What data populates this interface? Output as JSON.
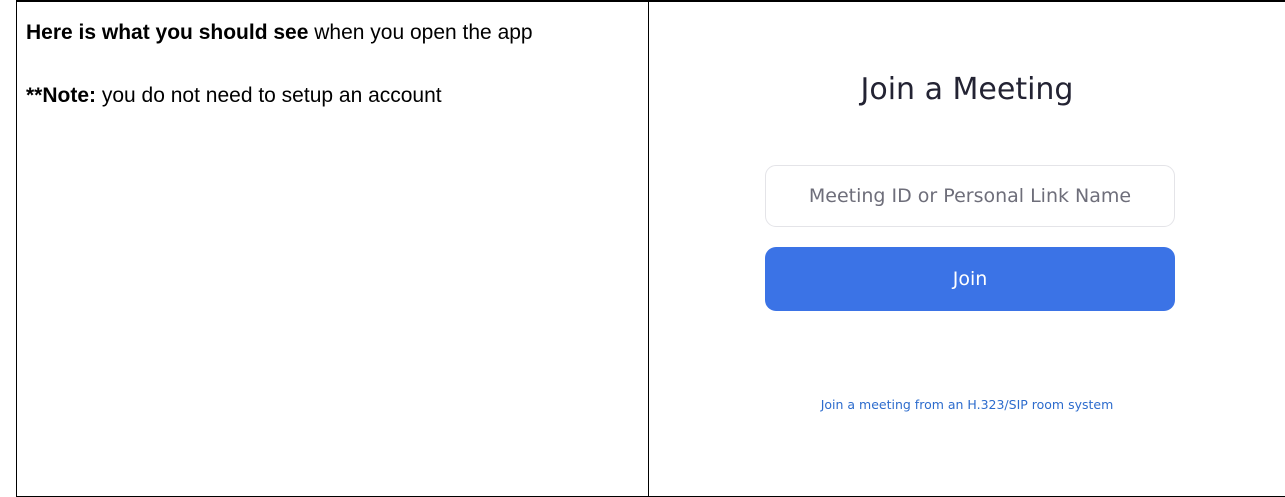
{
  "left_cell": {
    "intro_bold": "Here is what you should see",
    "intro_rest": " when you open the app",
    "note_prefix": "**",
    "note_bold": "Note:",
    "note_rest": " you do not need to setup an account"
  },
  "join_panel": {
    "title": "Join a Meeting",
    "meeting_input": {
      "value": "",
      "placeholder": "Meeting ID or Personal Link Name"
    },
    "join_button_label": "Join",
    "sip_link_text": "Join a meeting from an H.323/SIP room system"
  },
  "colors": {
    "join_button": "#3b73e6",
    "link": "#2d6ccd",
    "title_text": "#232333"
  }
}
